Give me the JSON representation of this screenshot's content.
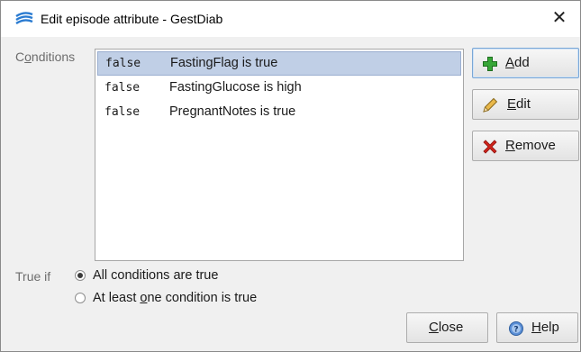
{
  "window": {
    "title": "Edit episode attribute - GestDiab",
    "close_glyph": "✕"
  },
  "conditions": {
    "label_pre": "C",
    "label_ul": "o",
    "label_post": "nditions",
    "rows": [
      {
        "value": "false",
        "text": "FastingFlag is true",
        "selected": true
      },
      {
        "value": "false",
        "text": "FastingGlucose is high",
        "selected": false
      },
      {
        "value": "false",
        "text": "PregnantNotes is true",
        "selected": false
      }
    ]
  },
  "buttons": {
    "add": {
      "ul": "A",
      "rest": "dd",
      "icon": "plus-icon"
    },
    "edit": {
      "ul": "E",
      "rest": "dit",
      "icon": "pencil-icon"
    },
    "remove": {
      "ul": "R",
      "rest": "emove",
      "icon": "red-x-icon"
    },
    "close": {
      "ul": "C",
      "rest": "lose"
    },
    "help": {
      "ul": "H",
      "rest": "elp",
      "icon": "help-icon"
    }
  },
  "true_if": {
    "label": "True if",
    "option_all": "All conditions are true",
    "option_one_pre": "At least ",
    "option_one_ul": "o",
    "option_one_post": "ne condition is true",
    "selected": "all"
  },
  "colors": {
    "selection": "#c0cfe6",
    "accent": "#7aa7d6",
    "add_green": "#2e9e2e",
    "remove_red": "#d0241c"
  }
}
